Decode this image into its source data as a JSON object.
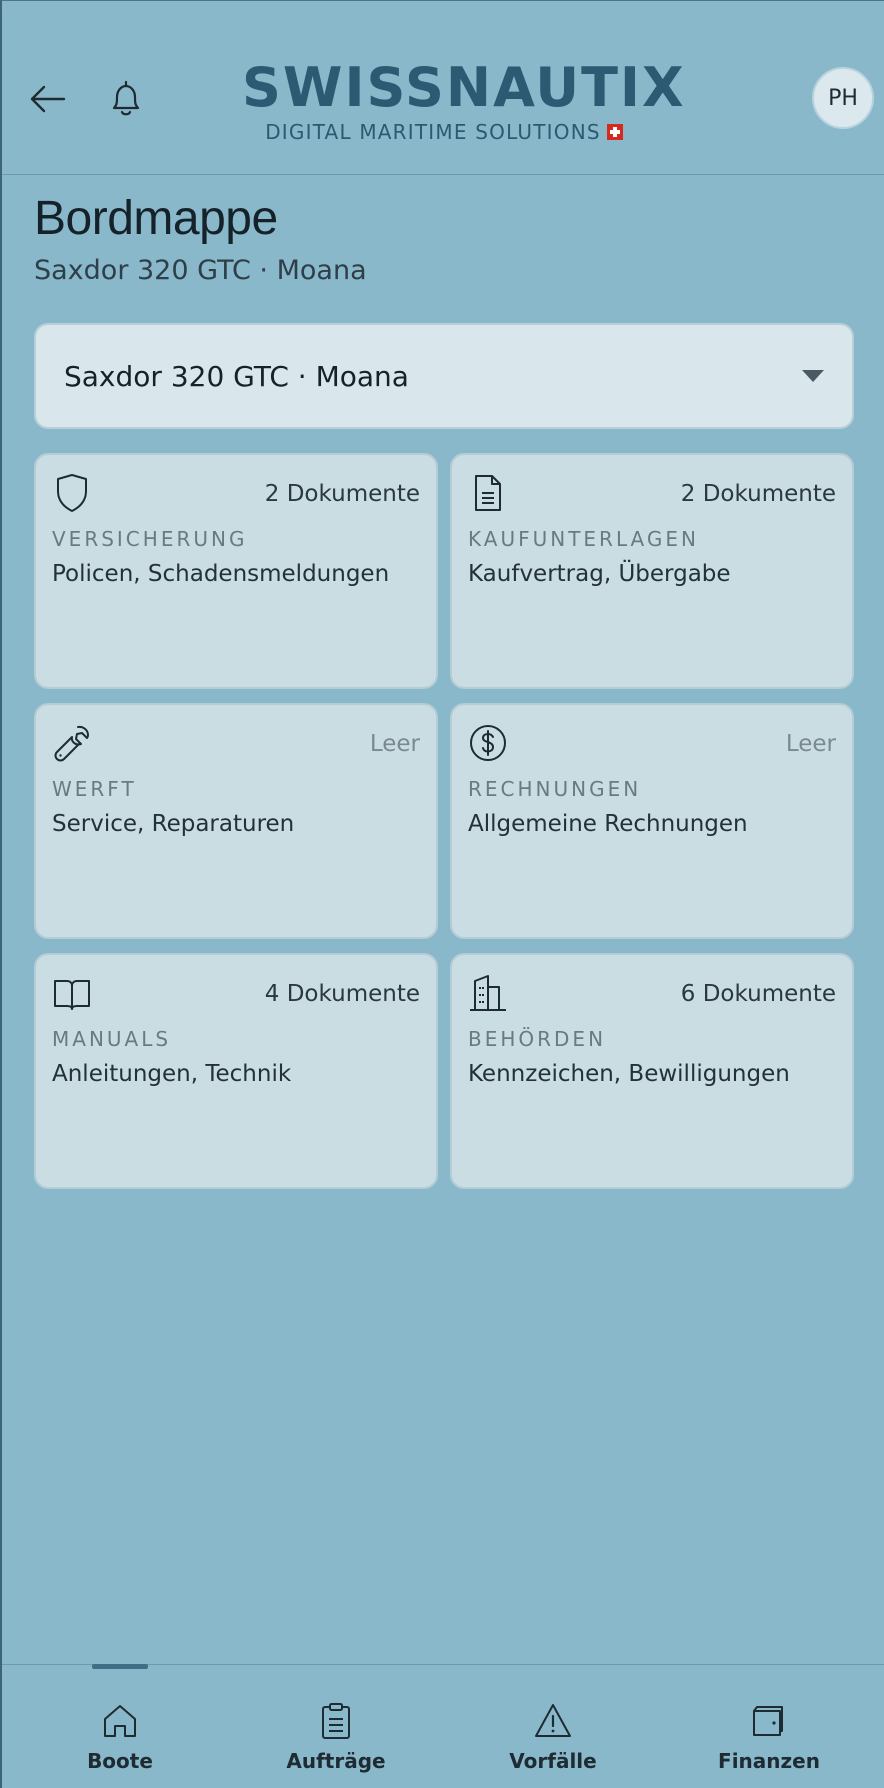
{
  "header": {
    "logo_main": "SWISSNAUTIX",
    "logo_sub": "DIGITAL MARITIME SOLUTIONS",
    "avatar_initials": "PH"
  },
  "page": {
    "title": "Bordmappe",
    "subtitle": "Saxdor 320 GTC · Moana"
  },
  "boat_select": {
    "selected": "Saxdor 320 GTC · Moana"
  },
  "categories": [
    {
      "icon": "shield-icon",
      "count": "2 Dokumente",
      "name": "VERSICHERUNG",
      "desc": "Policen, Schadensmeldungen"
    },
    {
      "icon": "document-icon",
      "count": "2 Dokumente",
      "name": "KAUFUNTERLAGEN",
      "desc": "Kaufvertrag, Übergabe"
    },
    {
      "icon": "wrench-icon",
      "count": "Leer",
      "name": "WERFT",
      "desc": "Service, Reparaturen"
    },
    {
      "icon": "dollar-icon",
      "count": "Leer",
      "name": "RECHNUNGEN",
      "desc": "Allgemeine Rechnungen"
    },
    {
      "icon": "book-icon",
      "count": "4 Dokumente",
      "name": "MANUALS",
      "desc": "Anleitungen, Technik"
    },
    {
      "icon": "building-icon",
      "count": "6 Dokumente",
      "name": "BEHÖRDEN",
      "desc": "Kennzeichen, Bewilligungen"
    }
  ],
  "nav": [
    {
      "label": "Boote",
      "icon": "home-icon",
      "active": true
    },
    {
      "label": "Aufträge",
      "icon": "clipboard-icon",
      "active": false
    },
    {
      "label": "Vorfälle",
      "icon": "warning-icon",
      "active": false
    },
    {
      "label": "Finanzen",
      "icon": "wallet-icon",
      "active": false
    }
  ],
  "colors": {
    "background": "#89b8ca",
    "brand": "#2b5a72",
    "card": "#c9dde3",
    "select": "#d9e7ec"
  }
}
